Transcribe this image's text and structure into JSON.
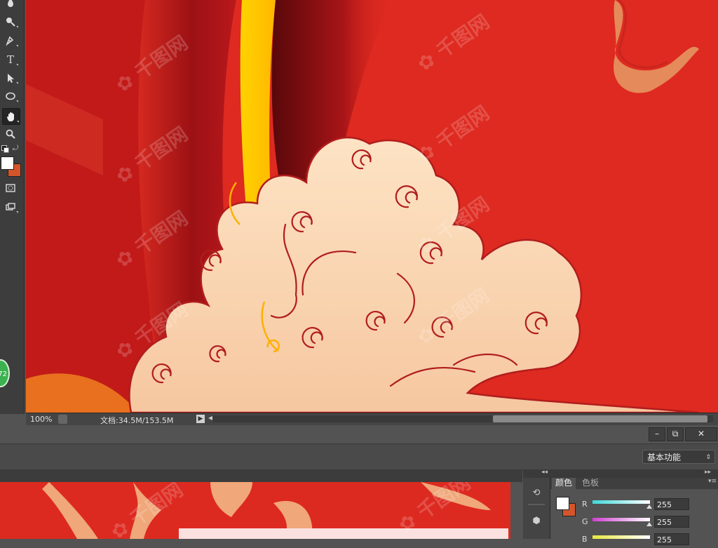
{
  "tools": [
    {
      "name": "blur-tool",
      "icon": "blur-drop-icon"
    },
    {
      "name": "dodge-tool",
      "icon": "dodge-icon"
    },
    {
      "name": "pen-tool",
      "icon": "pen-icon"
    },
    {
      "name": "type-tool",
      "icon": "type-icon",
      "glyph": "T"
    },
    {
      "name": "path-selection-tool",
      "icon": "arrow-icon"
    },
    {
      "name": "ellipse-tool",
      "icon": "ellipse-icon"
    },
    {
      "name": "hand-tool",
      "icon": "hand-icon",
      "active": true
    },
    {
      "name": "zoom-tool",
      "icon": "magnifier-icon"
    }
  ],
  "colors": {
    "foreground": "#ffffff",
    "background": "#d4552a",
    "accent_slider_r": "#40d8d8",
    "accent_slider_g": "#d040d0",
    "accent_slider_b": "#e8e840"
  },
  "statusbar": {
    "zoom": "100%",
    "doc_info": "文档:34.5M/153.5M"
  },
  "window_controls": {
    "minimize": "–",
    "restore": "⧉",
    "close": "✕"
  },
  "optionsbar": {
    "workspace": "基本功能"
  },
  "panel": {
    "tabs": [
      {
        "label": "颜色",
        "active": true
      },
      {
        "label": "色板",
        "active": false
      }
    ],
    "channels": [
      {
        "label": "R",
        "value": "255"
      },
      {
        "label": "G",
        "value": "255"
      },
      {
        "label": "B",
        "value": "255"
      }
    ]
  },
  "overlay_badge": "72"
}
